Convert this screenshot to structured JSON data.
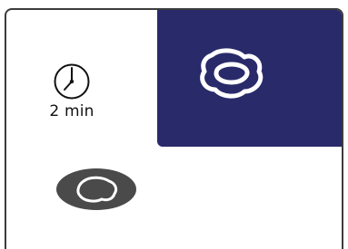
{
  "timer": {
    "icon": "clock-icon",
    "label": "2 min"
  },
  "options": [
    {
      "icon": "fried-egg-icon",
      "state": "selected",
      "background": "#282a6a",
      "icon_color": "#ffffff"
    },
    {
      "icon": "fried-egg-icon",
      "state": "unselected",
      "background": "#4a4a4a",
      "icon_color": "#ffffff"
    }
  ],
  "colors": {
    "accent": "#282a6a",
    "border": "#3c3c3c",
    "pill": "#4a4a4a",
    "text": "#111111"
  }
}
